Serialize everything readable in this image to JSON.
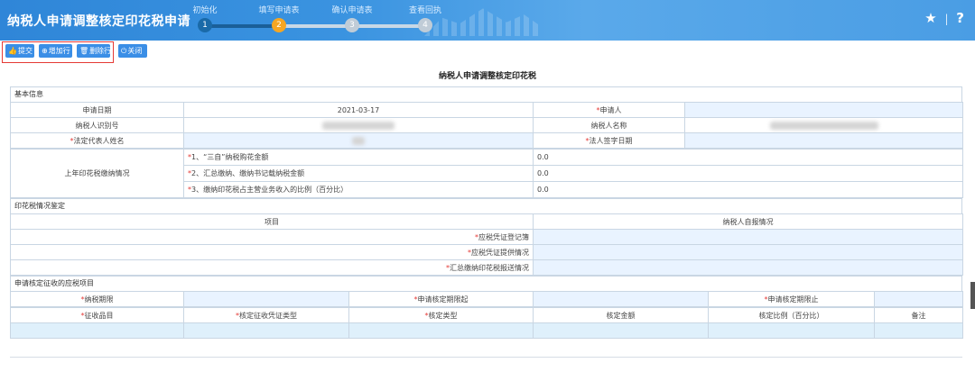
{
  "header": {
    "title": "纳税人申请调整核定印花税申请",
    "steps": [
      {
        "num": "1",
        "label": "初始化"
      },
      {
        "num": "2",
        "label": "填写申请表"
      },
      {
        "num": "3",
        "label": "确认申请表"
      },
      {
        "num": "4",
        "label": "查看回执"
      }
    ],
    "star_icon": "★",
    "help_icon": "?",
    "sep": "|"
  },
  "toolbar": {
    "submit": "提交",
    "add_row": "增加行",
    "delete_row": "删除行",
    "close": "关闭"
  },
  "page_title": "纳税人申请调整核定印花税",
  "sections": {
    "basic": "基本信息",
    "stamp_tax": "印花税情况鉴定",
    "apply_items": "申请核定征收的应税项目"
  },
  "basic": {
    "apply_date_label": "申请日期",
    "apply_date_value": "2021-03-17",
    "applicant_label": "申请人",
    "taxpayer_id_label": "纳税人识别号",
    "taxpayer_name_label": "纳税人名称",
    "legal_rep_label": "法定代表人姓名",
    "legal_sign_date_label": "法人签字日期",
    "last_year_label": "上年印花税缴纳情况",
    "q1": "1、“三自”纳税购花金额",
    "q1_value": "0.0",
    "q2": "2、汇总缴纳、缴纳书记载纳税金额",
    "q2_value": "0.0",
    "q3": "3、缴纳印花税占主营业务收入的比例（百分比）",
    "q3_value": "0.0"
  },
  "stamp": {
    "col_item": "项目",
    "col_self": "纳税人自报情况",
    "row1": "应税凭证登记簿",
    "row2": "应税凭证提供情况",
    "row3": "汇总缴纳印花税报送情况"
  },
  "apply": {
    "period": "纳税期限",
    "start": "申请核定期限起",
    "end": "申请核定期限止",
    "item": "征收品目",
    "voucher_type": "核定征收凭证类型",
    "assess_type": "核定类型",
    "amount": "核定金额",
    "ratio": "核定比例（百分比）",
    "remark": "备注"
  }
}
